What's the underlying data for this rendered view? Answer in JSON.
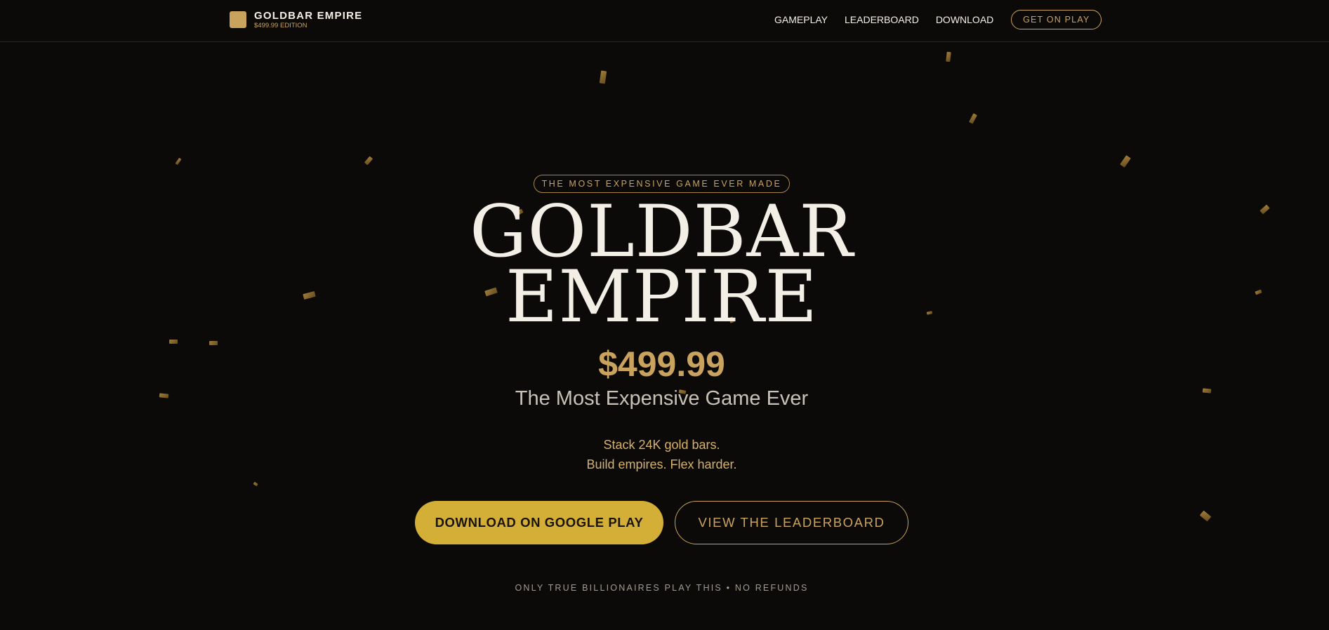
{
  "nav": {
    "brand_name": "GOLDBAR EMPIRE",
    "brand_edition": "$499.99 EDITION",
    "brand_icon": "gold-bar-logo",
    "links": [
      "GAMEPLAY",
      "LEADERBOARD",
      "DOWNLOAD"
    ],
    "cta": "GET ON PLAY"
  },
  "hero": {
    "eyebrow": "THE MOST EXPENSIVE GAME EVER MADE",
    "title_line1": "GOLDBAR",
    "title_line2": "EMPIRE",
    "price": "$499.99",
    "subtitle": "The Most Expensive Game Ever",
    "tagline_line1": "Stack 24K gold bars.",
    "tagline_line2": "Build empires. Flex harder.",
    "primary_button": "DOWNLOAD ON GOOGLE PLAY",
    "secondary_button": "VIEW THE LEADERBOARD",
    "footnote": "ONLY TRUE BILLIONAIRES PLAY THIS • NO REFUNDS"
  },
  "colors": {
    "background": "#0c0a09",
    "gold": "#c9a35e",
    "button_gold": "#d4af37",
    "text_light": "#f3efe6"
  }
}
